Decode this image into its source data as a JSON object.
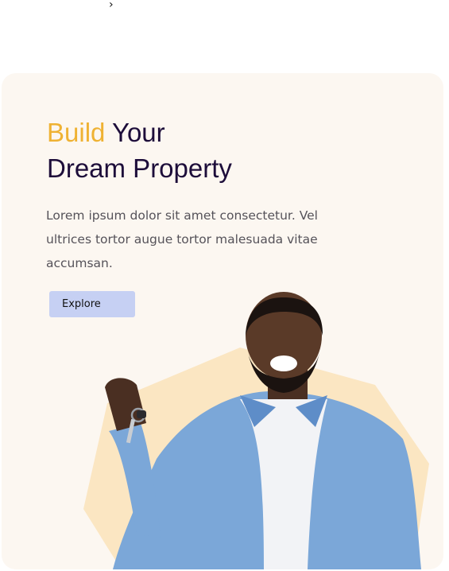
{
  "nav": {
    "chevron_icon": "chevron-right-icon"
  },
  "hero": {
    "title_accent": "Build",
    "title_rest": "Your",
    "title_line2": "Dream Property",
    "description": "Lorem ipsum dolor sit amet consectetur. Vel ultrices tortor augue tortor malesuada vitae accumsan.",
    "cta_label": "Explore"
  },
  "colors": {
    "accent": "#efb233",
    "heading": "#1d0d3a",
    "card_background": "#fcf7f1",
    "button_background": "#c6d0f3",
    "shape_background": "#fbe6c2"
  },
  "image": {
    "subject": "smiling man holding house keys"
  }
}
